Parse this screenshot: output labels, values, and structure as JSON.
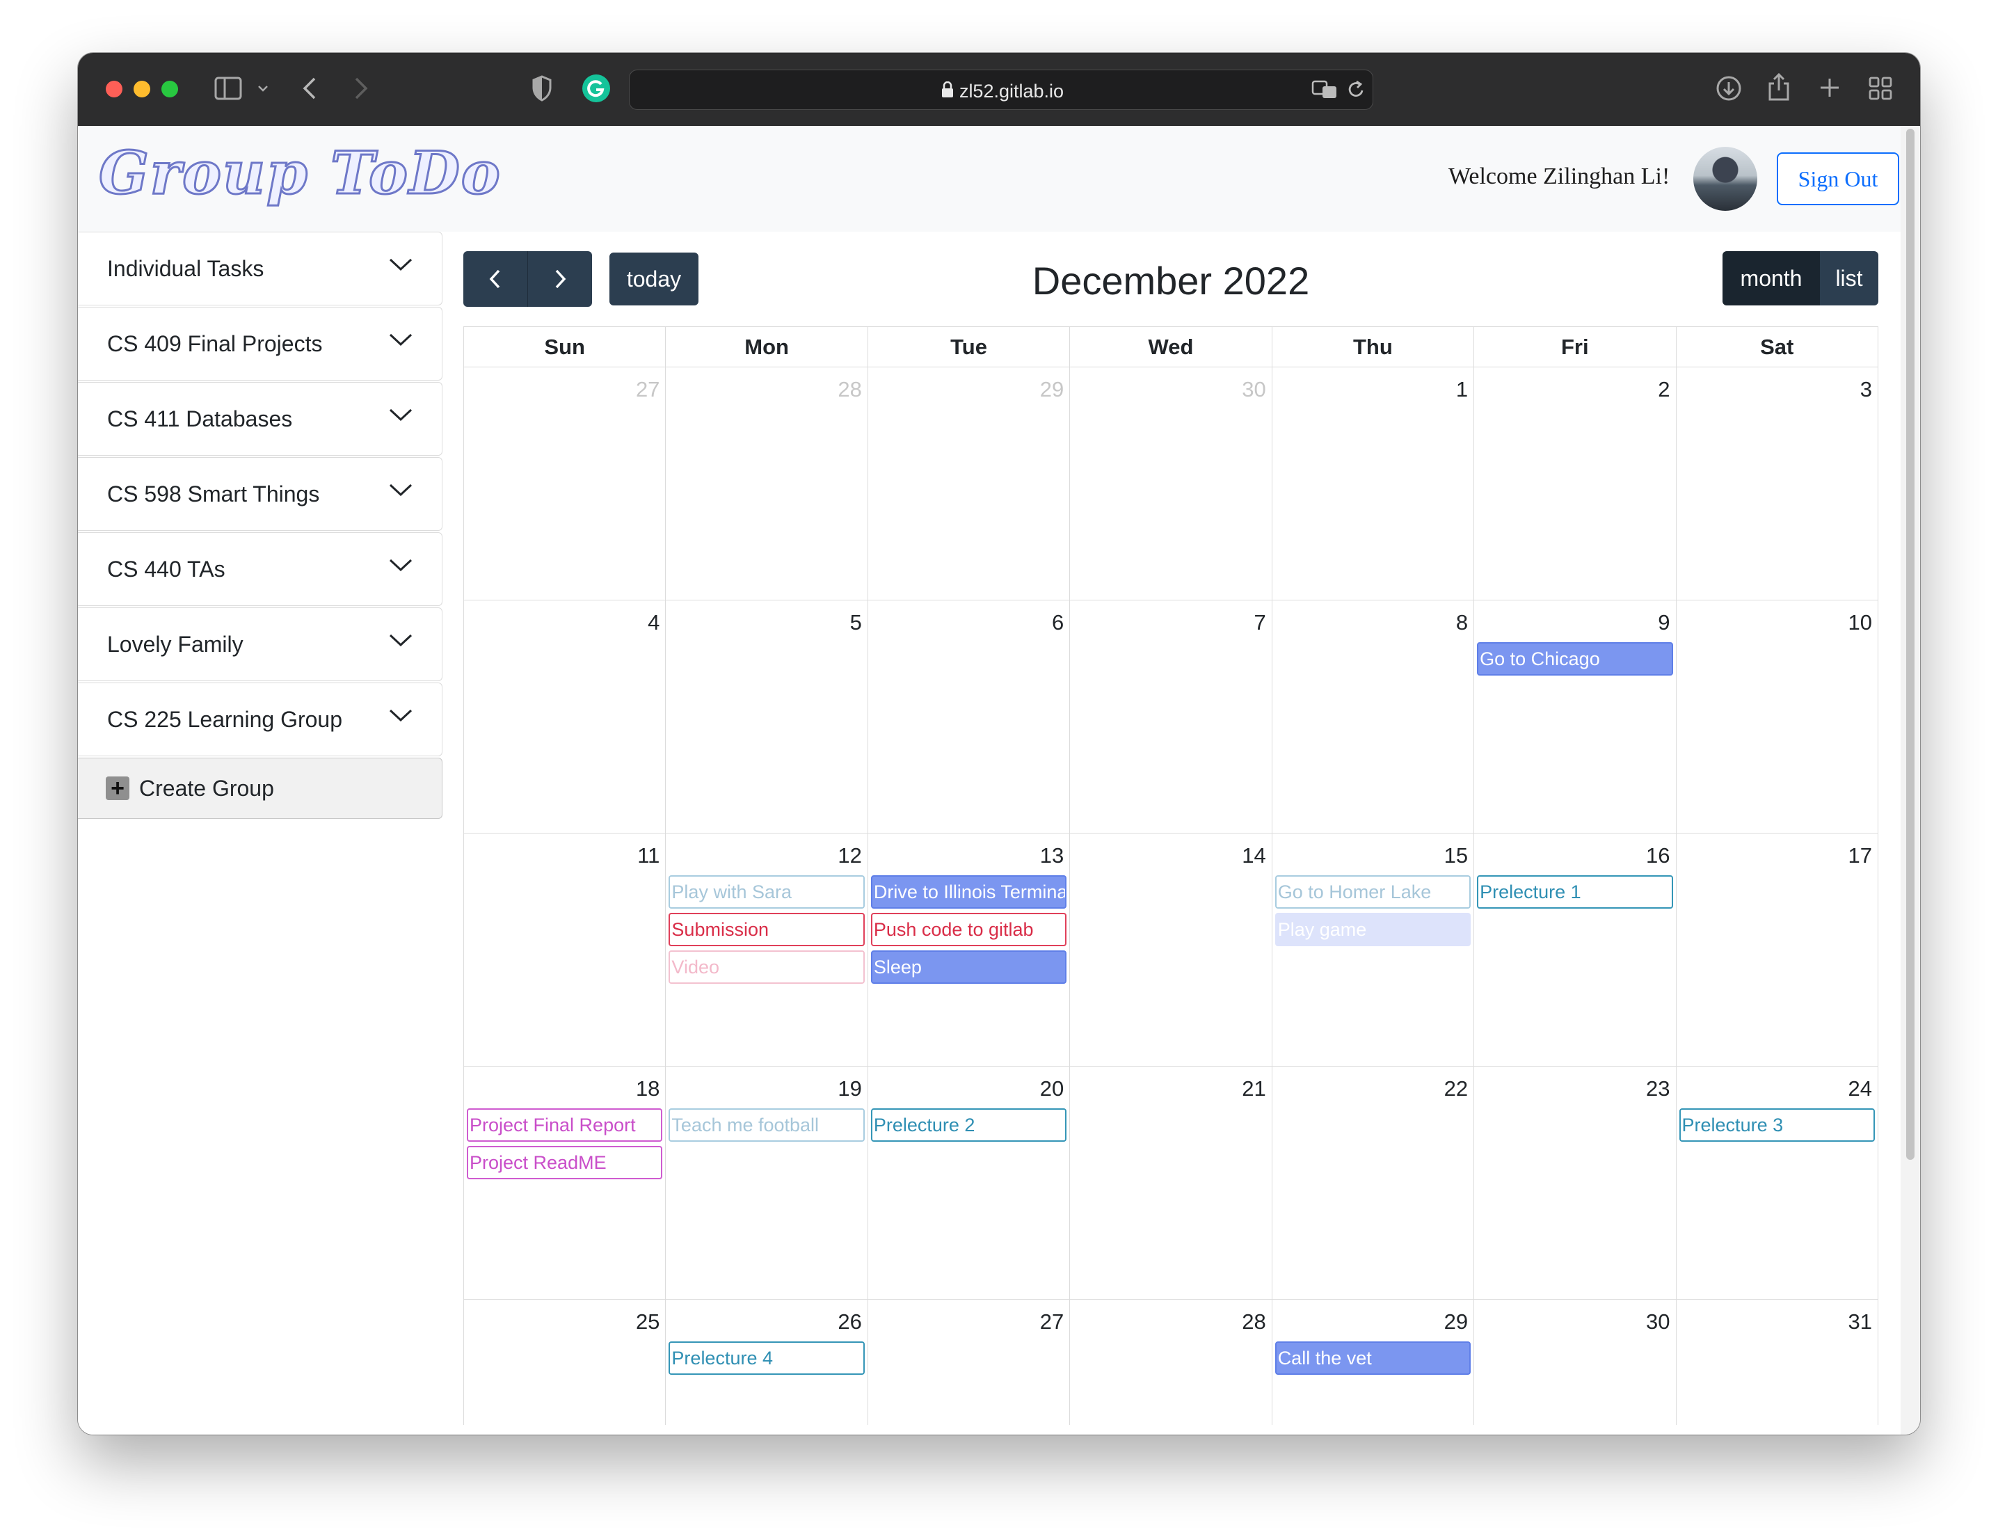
{
  "browser": {
    "url": "zl52.gitlab.io"
  },
  "header": {
    "logo": "Group ToDo",
    "welcome": "Welcome Zilinghan Li!",
    "signout_label": "Sign Out"
  },
  "sidebar": {
    "groups": [
      {
        "label": "Individual Tasks"
      },
      {
        "label": "CS 409 Final Projects"
      },
      {
        "label": "CS 411 Databases"
      },
      {
        "label": "CS 598 Smart Things"
      },
      {
        "label": "CS 440 TAs"
      },
      {
        "label": "Lovely Family"
      },
      {
        "label": "CS 225 Learning Group"
      }
    ],
    "create_label": "Create Group"
  },
  "calendar": {
    "title": "December 2022",
    "today_label": "today",
    "view_month_label": "month",
    "view_list_label": "list",
    "weekdays": [
      "Sun",
      "Mon",
      "Tue",
      "Wed",
      "Thu",
      "Fri",
      "Sat"
    ],
    "weeks": [
      [
        {
          "day": "27",
          "other": true,
          "events": []
        },
        {
          "day": "28",
          "other": true,
          "events": []
        },
        {
          "day": "29",
          "other": true,
          "events": []
        },
        {
          "day": "30",
          "other": true,
          "events": []
        },
        {
          "day": "1",
          "events": []
        },
        {
          "day": "2",
          "events": []
        },
        {
          "day": "3",
          "events": []
        }
      ],
      [
        {
          "day": "4",
          "events": []
        },
        {
          "day": "5",
          "events": []
        },
        {
          "day": "6",
          "events": []
        },
        {
          "day": "7",
          "events": []
        },
        {
          "day": "8",
          "events": []
        },
        {
          "day": "9",
          "events": [
            {
              "title": "Go to Chicago",
              "style": "filled-blue"
            }
          ]
        },
        {
          "day": "10",
          "events": []
        }
      ],
      [
        {
          "day": "11",
          "events": []
        },
        {
          "day": "12",
          "events": [
            {
              "title": "Play with Sara",
              "style": "outline-lightblue"
            },
            {
              "title": "Submission",
              "style": "outline-red"
            },
            {
              "title": "Video",
              "style": "outline-pink"
            }
          ]
        },
        {
          "day": "13",
          "events": [
            {
              "title": "Drive to Illinois Terminal",
              "style": "filled-blue"
            },
            {
              "title": "Push code to gitlab",
              "style": "outline-red"
            },
            {
              "title": "Sleep",
              "style": "filled-blue"
            }
          ]
        },
        {
          "day": "14",
          "events": []
        },
        {
          "day": "15",
          "events": [
            {
              "title": "Go to Homer Lake",
              "style": "outline-lightblue"
            },
            {
              "title": "Play game",
              "style": "filled-paleblue"
            }
          ]
        },
        {
          "day": "16",
          "events": [
            {
              "title": "Prelecture 1",
              "style": "outline-teal"
            }
          ]
        },
        {
          "day": "17",
          "events": []
        }
      ],
      [
        {
          "day": "18",
          "events": [
            {
              "title": "Project Final Report",
              "style": "outline-magenta"
            },
            {
              "title": "Project ReadME",
              "style": "outline-magenta"
            }
          ]
        },
        {
          "day": "19",
          "events": [
            {
              "title": "Teach me football",
              "style": "outline-lightblue"
            }
          ]
        },
        {
          "day": "20",
          "events": [
            {
              "title": "Prelecture 2",
              "style": "outline-teal"
            }
          ]
        },
        {
          "day": "21",
          "events": []
        },
        {
          "day": "22",
          "events": []
        },
        {
          "day": "23",
          "events": []
        },
        {
          "day": "24",
          "events": [
            {
              "title": "Prelecture 3",
              "style": "outline-teal"
            }
          ]
        }
      ],
      [
        {
          "day": "25",
          "events": []
        },
        {
          "day": "26",
          "events": [
            {
              "title": "Prelecture 4",
              "style": "outline-teal"
            }
          ]
        },
        {
          "day": "27",
          "events": []
        },
        {
          "day": "28",
          "events": []
        },
        {
          "day": "29",
          "events": [
            {
              "title": "Call the vet",
              "style": "filled-blue"
            }
          ]
        },
        {
          "day": "30",
          "events": []
        },
        {
          "day": "31",
          "events": []
        }
      ]
    ]
  },
  "event_styles": {
    "filled-blue": {
      "bg": "#7b96f0",
      "border": "#5f7fe8",
      "color": "#ffffff"
    },
    "filled-paleblue": {
      "bg": "#dde3fb",
      "border": "#dde3fb",
      "color": "#ffffff"
    },
    "outline-lightblue": {
      "bg": "#ffffff",
      "border": "#a9cde0",
      "color": "#a6c6d9"
    },
    "outline-red": {
      "bg": "#ffffff",
      "border": "#e0405a",
      "color": "#d92d48"
    },
    "outline-pink": {
      "bg": "#ffffff",
      "border": "#f3c2d0",
      "color": "#f3b9ca"
    },
    "outline-teal": {
      "bg": "#ffffff",
      "border": "#3596b7",
      "color": "#2f8fb3"
    },
    "outline-magenta": {
      "bg": "#ffffff",
      "border": "#cf5cd0",
      "color": "#c94ec9"
    }
  }
}
